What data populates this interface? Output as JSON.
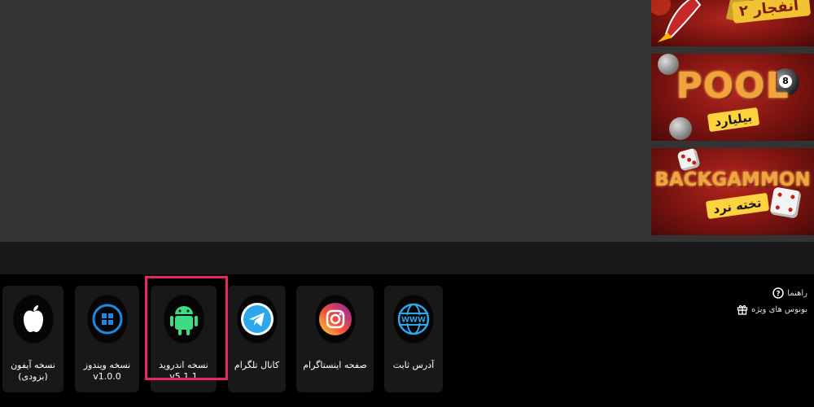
{
  "banners": [
    {
      "title_fa": "انفجار ۲",
      "accent": "#7e1410"
    },
    {
      "title": "POOL",
      "subtitle": "بیلیارد",
      "ball_number": "8"
    },
    {
      "title": "BACKGAMMON",
      "subtitle": "تخته نرد"
    }
  ],
  "footer": {
    "cards": [
      {
        "id": "iphone",
        "label_line1": "نسخه آیفون",
        "label_line2": "(بزودی)",
        "icon": "apple-icon"
      },
      {
        "id": "windows",
        "label_line1": "نسخه ویندوز",
        "label_line2": "v1.0.0",
        "icon": "windows-icon"
      },
      {
        "id": "android",
        "label_line1": "نسخه اندروید",
        "label_line2": "v5.1.1",
        "icon": "android-icon"
      },
      {
        "id": "telegram",
        "label_line1": "کانال تلگرام",
        "label_line2": "",
        "icon": "telegram-icon"
      },
      {
        "id": "instagram",
        "label_line1": "صفحه اینستاگرام",
        "label_line2": "",
        "icon": "instagram-icon"
      },
      {
        "id": "website",
        "label_line1": "آدرس ثابت",
        "label_line2": "",
        "icon": "www-globe-icon"
      }
    ],
    "side_links": [
      {
        "label": "راهنما",
        "icon": "question-icon"
      },
      {
        "label": "بونوس های ویژه",
        "icon": "gift-icon"
      }
    ],
    "www_text": "WWW"
  },
  "colors": {
    "highlight": "#e8275e",
    "android": "#3ddc84",
    "windows": "#1e88e5",
    "telegram": "#29a9eb"
  }
}
